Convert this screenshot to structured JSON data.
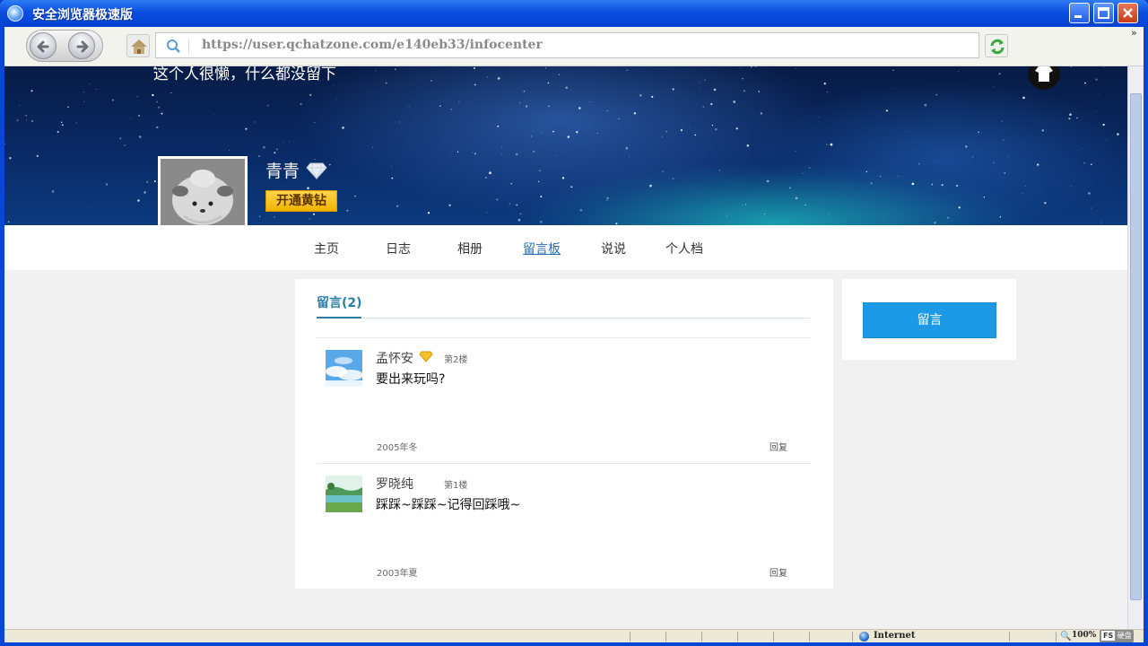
{
  "window": {
    "title": "安全浏览器极速版",
    "colors": {
      "titlebar": "#0a4fe0",
      "close_button": "#c73b16"
    }
  },
  "toolbar": {
    "address": "https://user.qchatzone.com/e140eb33/infocenter",
    "overflow_chevron": "»"
  },
  "profile": {
    "signature": "这个人很懒，什么都没留下",
    "username": "青青",
    "vip_button": "开通黄钻"
  },
  "nav": {
    "items": [
      "主页",
      "日志",
      "相册",
      "留言板",
      "说说",
      "个人档"
    ],
    "active": "留言板",
    "accent": "#2a6fb0"
  },
  "guestbook": {
    "title": "留言(2)",
    "messages": [
      {
        "author": "孟怀安",
        "floor": "第2楼",
        "content": "要出来玩吗?",
        "date": "2005年冬",
        "reply": "回复",
        "has_vip_icon": true,
        "avatar": "sky-clouds-icon"
      },
      {
        "author": "罗晓纯",
        "floor": "第1楼",
        "content": "踩踩~踩踩~记得回踩哦~",
        "date": "2003年夏",
        "reply": "回复",
        "has_vip_icon": false,
        "avatar": "landscape-icon"
      }
    ]
  },
  "sidebar": {
    "post_button": "留言",
    "button_color": "#1d9ae6"
  },
  "statusbar": {
    "zone": "Internet",
    "zoom": "100%",
    "fs_label": "FS",
    "fs_text": "硬盘"
  }
}
